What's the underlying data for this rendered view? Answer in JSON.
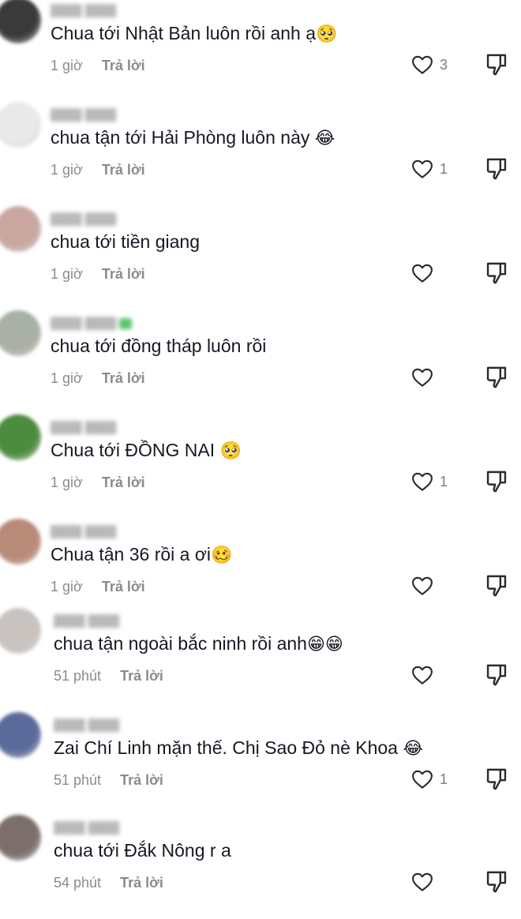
{
  "comments": [
    {
      "text": "Chua tới Nhật Bản luôn rồi anh ạ",
      "emoji": "🥺",
      "time": "1 giờ",
      "reply": "Trả lời",
      "likes": "3",
      "avatar_color": "#3a3a3a"
    },
    {
      "text": "chua tận tới Hải Phòng luôn này ",
      "emoji": "😂",
      "time": "1 giờ",
      "reply": "Trả lời",
      "likes": "1",
      "avatar_color": "#e9e9e9"
    },
    {
      "text": "chua tới tiền giang",
      "emoji": "",
      "time": "1 giờ",
      "reply": "Trả lời",
      "likes": "",
      "avatar_color": "#c9a7a0"
    },
    {
      "text": "chua tới đồng tháp luôn rồi",
      "emoji": "",
      "time": "1 giờ",
      "reply": "Trả lời",
      "likes": "",
      "avatar_color": "#a9b0a6"
    },
    {
      "text": "Chua tới ĐỒNG NAI ",
      "emoji": "🥺",
      "time": "1 giờ",
      "reply": "Trả lời",
      "likes": "1",
      "avatar_color": "#4c8c3e"
    },
    {
      "text": "Chua tận 36 rồi a ơi",
      "emoji": "🥴",
      "time": "1 giờ",
      "reply": "Trả lời",
      "likes": "",
      "avatar_color": "#b88a78"
    },
    {
      "text": "chua tận ngoài bắc ninh rồi anh",
      "emoji": "😁😁",
      "time": "51 phút",
      "reply": "Trả lời",
      "likes": "",
      "avatar_color": "#c9c3c0"
    },
    {
      "text": "Zai Chí Linh mặn thế. Chị Sao Đỏ nè Khoa ",
      "emoji": "😂",
      "time": "51 phút",
      "reply": "Trả lời",
      "likes": "1",
      "avatar_color": "#5a6a9a"
    },
    {
      "text": "chua tới Đắk Nông r a",
      "emoji": "",
      "time": "54 phút",
      "reply": "Trả lời",
      "likes": "",
      "avatar_color": "#7c6e6a"
    }
  ],
  "icons": {
    "like": "heart-outline-icon",
    "dislike": "thumbs-down-icon"
  },
  "colors": {
    "text": "#161823",
    "meta": "#8a8b91",
    "icon": "#2b2b2b"
  }
}
